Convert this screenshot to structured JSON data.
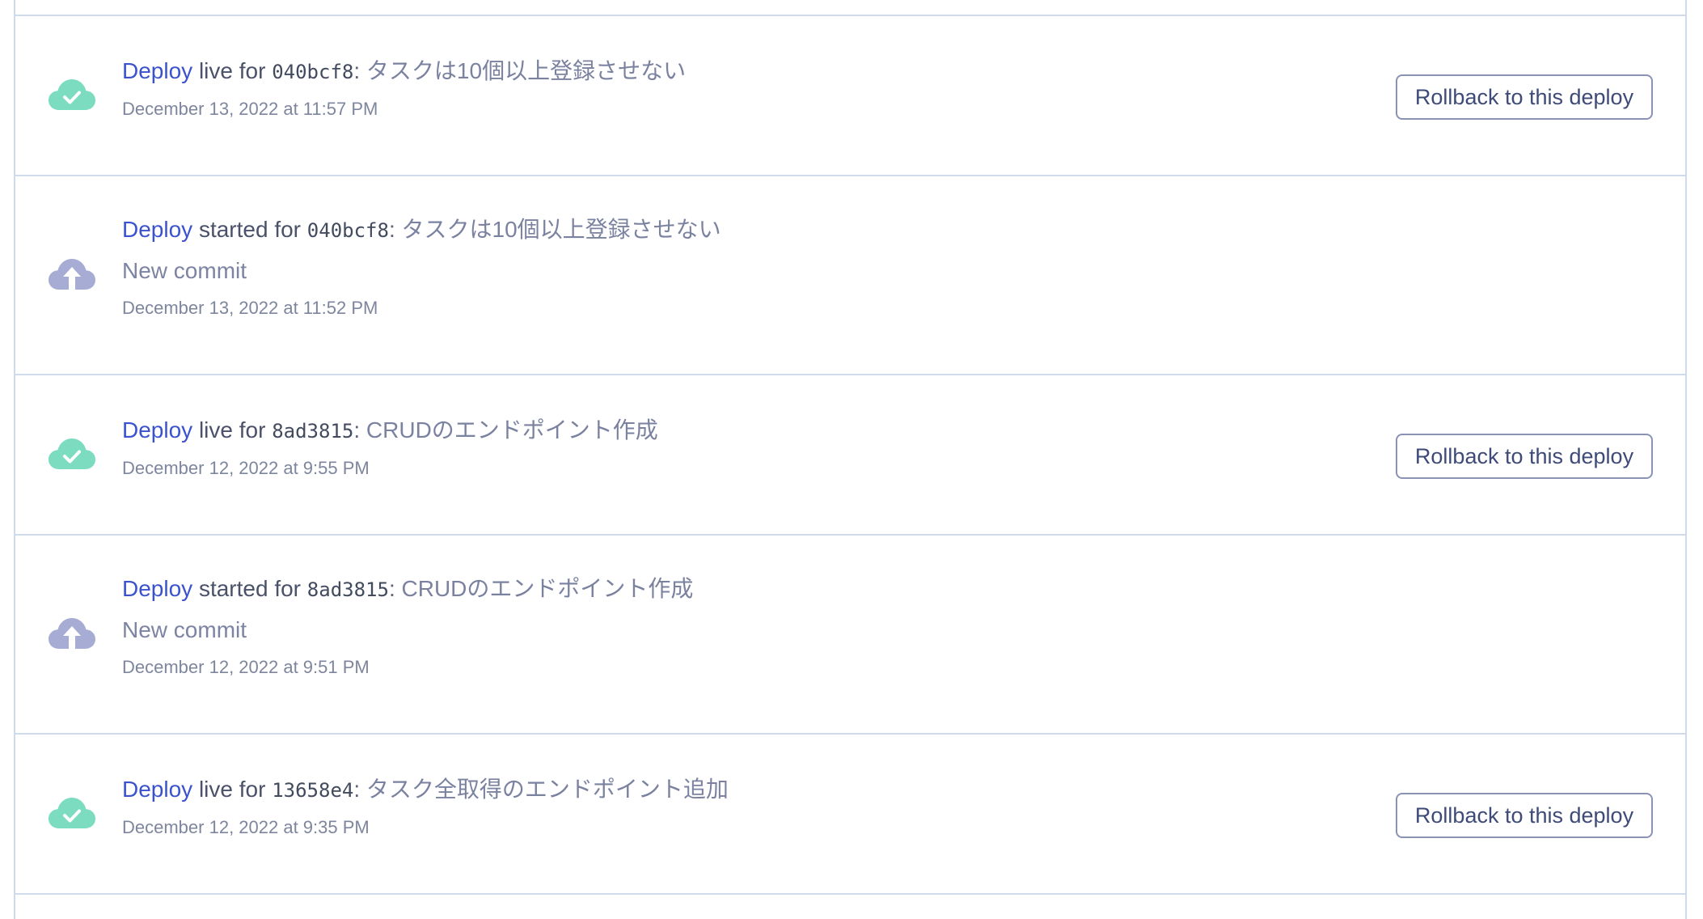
{
  "colors": {
    "live_icon": "#7bdcbf",
    "started_icon": "#a6acd4",
    "link": "#3b52ce",
    "divider": "#cfdaea",
    "button_border": "#8a93b3"
  },
  "events": [
    {
      "status": "live",
      "icon": "cloud-check-icon",
      "link_label": "Deploy",
      "verb": "live for",
      "sha": "040bcf8",
      "separator": ":",
      "message": "タスクは10個以上登録させない",
      "subtitle": "",
      "timestamp": "December 13, 2022 at 11:57 PM",
      "action_label": "Rollback to this deploy"
    },
    {
      "status": "started",
      "icon": "cloud-upload-icon",
      "link_label": "Deploy",
      "verb": "started for",
      "sha": "040bcf8",
      "separator": ":",
      "message": "タスクは10個以上登録させない",
      "subtitle": "New commit",
      "timestamp": "December 13, 2022 at 11:52 PM",
      "action_label": ""
    },
    {
      "status": "live",
      "icon": "cloud-check-icon",
      "link_label": "Deploy",
      "verb": "live for",
      "sha": "8ad3815",
      "separator": ":",
      "message": "CRUDのエンドポイント作成",
      "subtitle": "",
      "timestamp": "December 12, 2022 at 9:55 PM",
      "action_label": "Rollback to this deploy"
    },
    {
      "status": "started",
      "icon": "cloud-upload-icon",
      "link_label": "Deploy",
      "verb": "started for",
      "sha": "8ad3815",
      "separator": ":",
      "message": "CRUDのエンドポイント作成",
      "subtitle": "New commit",
      "timestamp": "December 12, 2022 at 9:51 PM",
      "action_label": ""
    },
    {
      "status": "live",
      "icon": "cloud-check-icon",
      "link_label": "Deploy",
      "verb": "live for",
      "sha": "13658e4",
      "separator": ":",
      "message": "タスク全取得のエンドポイント追加",
      "subtitle": "",
      "timestamp": "December 12, 2022 at 9:35 PM",
      "action_label": "Rollback to this deploy"
    }
  ]
}
